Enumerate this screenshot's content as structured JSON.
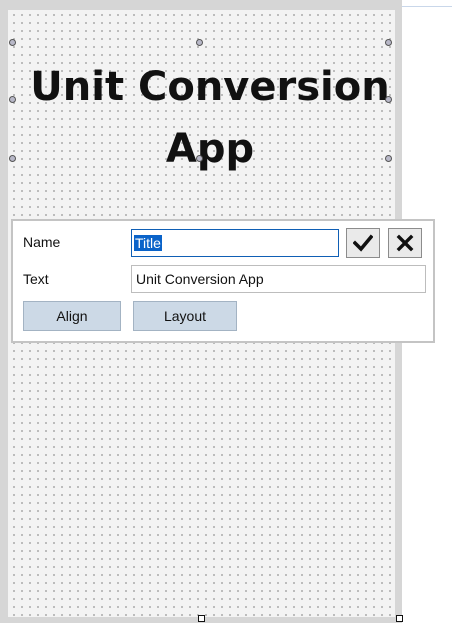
{
  "form": {
    "title_line1": "Unit Conversion",
    "title_line2": "App"
  },
  "popup": {
    "name_label": "Name",
    "name_value": "Title",
    "text_label": "Text",
    "text_value": "Unit Conversion App",
    "confirm_icon": "check-icon",
    "cancel_icon": "close-icon",
    "align_label": "Align",
    "layout_label": "Layout"
  },
  "colors": {
    "selection": "#0a63c9",
    "button_bg": "#ccd9e6",
    "focus_border": "#0f5fb5"
  }
}
